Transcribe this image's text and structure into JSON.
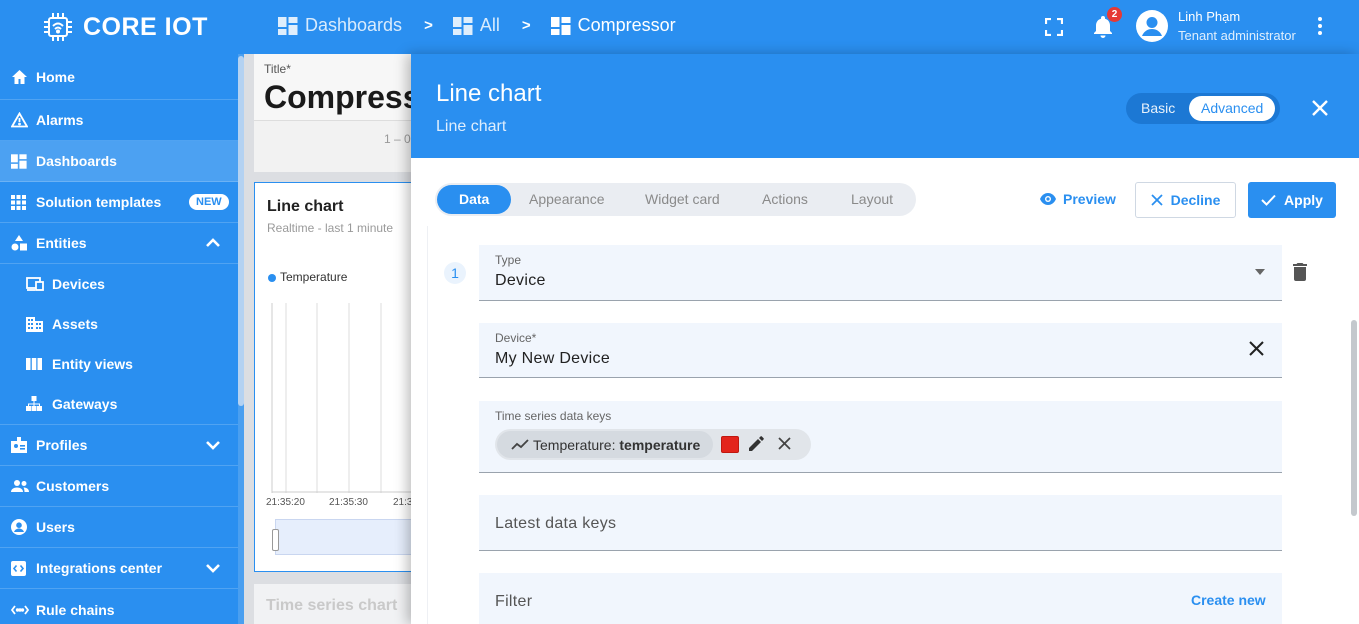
{
  "app": {
    "logo_text": "CORE IOT"
  },
  "breadcrumb": [
    {
      "label": "Dashboards",
      "icon": "dashboard-icon"
    },
    {
      "label": "All",
      "icon": "dashboard-icon"
    },
    {
      "label": "Compressor",
      "icon": "dashboard-icon"
    }
  ],
  "breadcrumb_separator": ">",
  "topbar": {
    "notification_count": "2",
    "user_name": "Linh Phạm",
    "user_role": "Tenant administrator"
  },
  "sidebar": {
    "items": [
      {
        "label": "Home",
        "icon": "home-icon"
      },
      {
        "label": "Alarms",
        "icon": "alarm-icon"
      },
      {
        "label": "Dashboards",
        "icon": "dashboard-icon",
        "active": true
      },
      {
        "label": "Solution templates",
        "icon": "apps-icon",
        "badge": "NEW"
      },
      {
        "label": "Entities",
        "icon": "entities-icon",
        "expanded": true
      },
      {
        "label": "Devices",
        "icon": "devices-icon"
      },
      {
        "label": "Assets",
        "icon": "assets-icon"
      },
      {
        "label": "Entity views",
        "icon": "entity-views-icon"
      },
      {
        "label": "Gateways",
        "icon": "gateways-icon"
      },
      {
        "label": "Profiles",
        "icon": "profiles-icon",
        "expanded": false
      },
      {
        "label": "Customers",
        "icon": "customers-icon"
      },
      {
        "label": "Users",
        "icon": "users-icon"
      },
      {
        "label": "Integrations center",
        "icon": "integrations-icon",
        "expanded": false
      },
      {
        "label": "Rule chains",
        "icon": "rule-chains-icon"
      }
    ]
  },
  "dashboard": {
    "title_label": "Title*",
    "title_value": "Compressor",
    "range_text": "1 – 0",
    "widget": {
      "title": "Line chart",
      "subtitle": "Realtime - last 1 minute",
      "legend": "Temperature",
      "ticks": [
        "21:35:20",
        "21:35:30",
        "21:3"
      ]
    },
    "next_widget_title": "Time series chart"
  },
  "editor": {
    "title": "Line chart",
    "subtitle": "Line chart",
    "mode_basic": "Basic",
    "mode_advanced": "Advanced",
    "tabs": [
      "Data",
      "Appearance",
      "Widget card",
      "Actions",
      "Layout"
    ],
    "preview_label": "Preview",
    "decline_label": "Decline",
    "apply_label": "Apply",
    "datasource": {
      "index": "1",
      "type_label": "Type",
      "type_value": "Device",
      "device_label": "Device*",
      "device_value": "My New Device",
      "ts_keys_label": "Time series data keys",
      "ts_key": {
        "label": "Temperature:",
        "key": "temperature",
        "color": "#e3241c"
      },
      "latest_keys_placeholder": "Latest data keys",
      "filter_placeholder": "Filter",
      "create_new_label": "Create new"
    }
  },
  "colors": {
    "primary": "#2a8ff0",
    "toolbar": "#2a8ff0"
  }
}
